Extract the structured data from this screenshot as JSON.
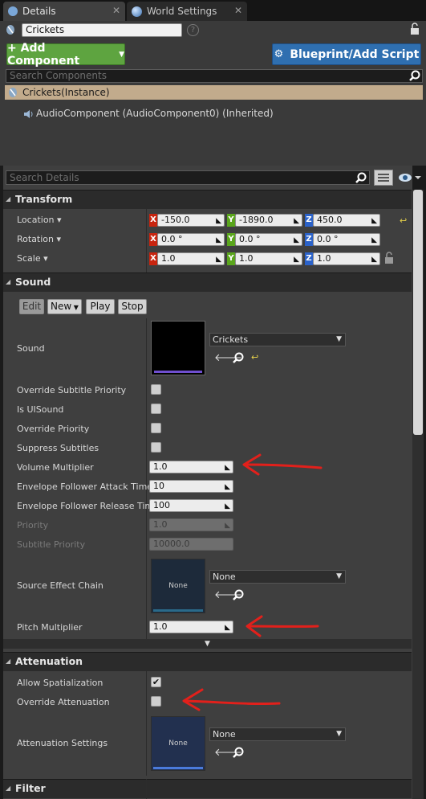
{
  "tabs": [
    {
      "label": "Details",
      "icon": "details-icon"
    },
    {
      "label": "World Settings",
      "icon": "globe-icon"
    }
  ],
  "actor_name": "Crickets",
  "buttons": {
    "add_component": "+ Add Component",
    "blueprint": "Blueprint/Add Script"
  },
  "components": {
    "search_placeholder": "Search Components",
    "instance": "Crickets(Instance)",
    "child": "AudioComponent (AudioComponent0) (Inherited)"
  },
  "details_search_placeholder": "Search Details",
  "transform": {
    "title": "Transform",
    "rows": [
      {
        "label": "Location",
        "x": "-150.0",
        "y": "-1890.0",
        "z": "450.0"
      },
      {
        "label": "Rotation",
        "x": "0.0 °",
        "y": "0.0 °",
        "z": "0.0 °"
      },
      {
        "label": "Scale",
        "x": "1.0",
        "y": "1.0",
        "z": "1.0"
      }
    ],
    "axis_labels": [
      "X",
      "Y",
      "Z"
    ]
  },
  "sound": {
    "title": "Sound",
    "buttons": {
      "edit": "Edit",
      "new": "New",
      "play": "Play",
      "stop": "Stop"
    },
    "sound_label": "Sound",
    "sound_asset": "Crickets",
    "checkboxes": [
      {
        "label": "Override Subtitle Priority",
        "checked": false
      },
      {
        "label": "Is UISound",
        "checked": false
      },
      {
        "label": "Override Priority",
        "checked": false
      },
      {
        "label": "Suppress Subtitles",
        "checked": false
      }
    ],
    "volume_label": "Volume Multiplier",
    "volume": "1.0",
    "attack_label": "Envelope Follower Attack Time",
    "attack": "10",
    "release_label": "Envelope Follower Release Time",
    "release": "100",
    "priority_label": "Priority",
    "priority": "1.0",
    "subtitle_priority_label": "Subtitle Priority",
    "subtitle_priority": "10000.0",
    "effect_chain_label": "Source Effect Chain",
    "effect_chain_thumb": "None",
    "effect_chain_value": "None",
    "pitch_label": "Pitch Multiplier",
    "pitch": "1.0"
  },
  "attenuation": {
    "title": "Attenuation",
    "allow_spatialization_label": "Allow Spatialization",
    "allow_spatialization": true,
    "override_attenuation_label": "Override Attenuation",
    "override_attenuation": false,
    "settings_label": "Attenuation Settings",
    "settings_thumb": "None",
    "settings_value": "None"
  },
  "filter": {
    "title": "Filter"
  },
  "colors": {
    "add_component": "#5ea440",
    "blueprint": "#2f6fb0",
    "instance_row": "#c2ab8c",
    "annotation": "#e2201b"
  }
}
